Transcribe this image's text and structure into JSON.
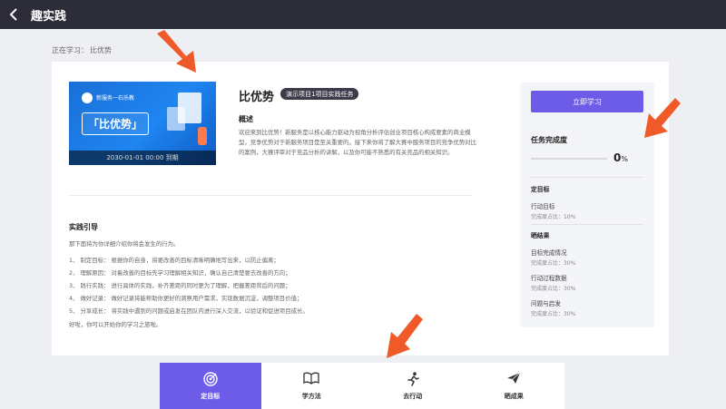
{
  "header": {
    "back_icon": "chevron-left-icon",
    "title": "趣实践"
  },
  "breadcrumb": {
    "prefix": "正在学习：",
    "current": "比优势"
  },
  "course": {
    "cover": {
      "brand": "新服务一石乐教",
      "title": "「比优势」",
      "footer": "2030-01-01 00:00 到期"
    },
    "title": "比优势",
    "badge": "演示项目1项目实践任务",
    "overview_heading": "概述",
    "overview_text": "欢迎来到比优势！新服务是以核心能力驱动为视角分析评估创业项目核心构成要素的商业模型，竞争优势对于新服务项目是至关重要的。接下来你将了解大赛中服务项目的竞争优势对比的案例，大赛评审对于竞品分析的讲解，以及你可能不熟悉的有关竞品的相关知识。"
  },
  "guide": {
    "heading": "实践引导",
    "intro": "那下面将为你详细介绍你将会发生的行为。",
    "steps": [
      "1、 制定目标：  根据你的自身，将要改善的目标清晰明确地写出来，以防止偏离；",
      "2、 理解原因：  对着改善的目标先学习理解相关知识，确认自己清楚要去改善的方向；",
      "3、 践行实践：  进行具体的实践，补齐差距的同时更为了理解，把握差距背后的问题；",
      "4、 做好记录：  做好记录将能帮助你更好的洞察用户需求，实现数据沉淀，调整项目价值；",
      "5、 分享成长：  将实践中遇到的问题或启发在团队内进行深入交流，以验证和促进项目成长。"
    ],
    "outro": "好啦，你可以开始你的学习之旅啦。"
  },
  "sidebar": {
    "start_button": "立即学习",
    "completion_heading": "任务完成度",
    "completion_percent": 0,
    "completion_value": "0",
    "completion_unit": "%",
    "sections": [
      {
        "title": "定目标",
        "items": [
          {
            "name": "行动目标",
            "detail": "完成度占比：10%"
          }
        ]
      },
      {
        "title": "晒结果",
        "items": [
          {
            "name": "目标完成情况",
            "detail": "完成度占比：30%"
          },
          {
            "name": "行动过程数据",
            "detail": "完成度占比：30%"
          },
          {
            "name": "问题与启发",
            "detail": "完成度占比：30%"
          }
        ]
      }
    ]
  },
  "tabs": [
    {
      "label": "定目标",
      "icon": "target-icon",
      "active": true
    },
    {
      "label": "学方法",
      "icon": "open-book-icon",
      "active": false
    },
    {
      "label": "去行动",
      "icon": "running-person-icon",
      "active": false
    },
    {
      "label": "晒成果",
      "icon": "paper-plane-icon",
      "active": false
    }
  ],
  "colors": {
    "accent": "#6c5ce7",
    "header_bg": "#2d2d3a",
    "annotation_arrow": "#f05a28"
  }
}
